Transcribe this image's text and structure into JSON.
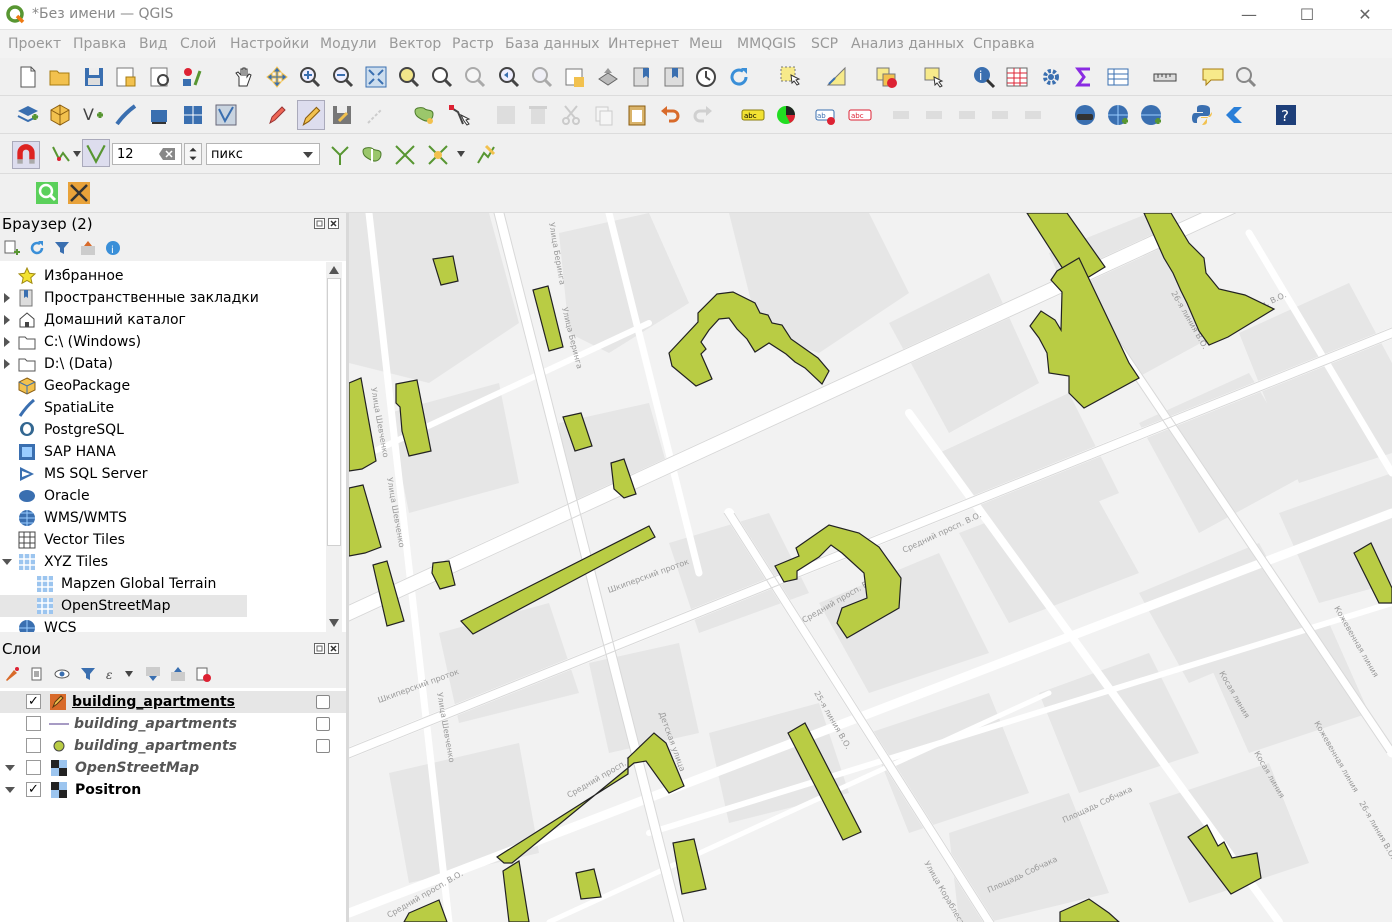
{
  "window": {
    "title": "*Без имени — QGIS",
    "controls": {
      "minimize": "—",
      "maximize": "☐",
      "close": "✕"
    }
  },
  "menu": [
    "Проект",
    "Правка",
    "Вид",
    "Слой",
    "Настройки",
    "Модули",
    "Вектор",
    "Растр",
    "База данных",
    "Интернет",
    "Меш",
    "MMQGIS",
    "SCP",
    "Анализ данных",
    "Справка"
  ],
  "snapping": {
    "tolerance_value": "12",
    "units_value": "пикс"
  },
  "browser": {
    "title": "Браузер (2)",
    "items": [
      {
        "label": "Избранное",
        "icon": "star-icon",
        "expander": ""
      },
      {
        "label": "Пространственные закладки",
        "icon": "bookmarks-icon",
        "expander": "collapsed"
      },
      {
        "label": "Домашний каталог",
        "icon": "home-folder-icon",
        "expander": "collapsed"
      },
      {
        "label": "C:\\ (Windows)",
        "icon": "folder-icon",
        "expander": "collapsed"
      },
      {
        "label": "D:\\ (Data)",
        "icon": "folder-icon",
        "expander": "collapsed"
      },
      {
        "label": "GeoPackage",
        "icon": "geopackage-icon",
        "expander": ""
      },
      {
        "label": "SpatiaLite",
        "icon": "spatialite-icon",
        "expander": ""
      },
      {
        "label": "PostgreSQL",
        "icon": "postgresql-icon",
        "expander": ""
      },
      {
        "label": "SAP HANA",
        "icon": "sap-hana-icon",
        "expander": ""
      },
      {
        "label": "MS SQL Server",
        "icon": "mssql-icon",
        "expander": ""
      },
      {
        "label": "Oracle",
        "icon": "oracle-icon",
        "expander": ""
      },
      {
        "label": "WMS/WMTS",
        "icon": "wms-globe-icon",
        "expander": ""
      },
      {
        "label": "Vector Tiles",
        "icon": "vector-tiles-icon",
        "expander": ""
      },
      {
        "label": "XYZ Tiles",
        "icon": "xyz-tiles-icon",
        "expander": "expanded"
      },
      {
        "label": "Mapzen Global Terrain",
        "icon": "xyz-tile-layer-icon",
        "expander": "child"
      },
      {
        "label": "OpenStreetMap",
        "icon": "xyz-tile-layer-icon",
        "expander": "child"
      },
      {
        "label": "WCS",
        "icon": "wcs-globe-icon",
        "expander": ""
      }
    ]
  },
  "layers": {
    "title": "Слои",
    "items": [
      {
        "label": "building_apartments",
        "checked": true,
        "symbol": "polygon-edit",
        "underline": true,
        "italic": false
      },
      {
        "label": "building_apartments",
        "checked": false,
        "symbol": "line",
        "underline": false,
        "italic": true
      },
      {
        "label": "building_apartments",
        "checked": false,
        "symbol": "point",
        "underline": false,
        "italic": true
      },
      {
        "label": "OpenStreetMap",
        "checked": false,
        "symbol": "raster",
        "underline": false,
        "italic": true,
        "expander": "expanded"
      },
      {
        "label": "Positron",
        "checked": true,
        "symbol": "raster",
        "underline": false,
        "italic": false,
        "expander": "expanded"
      }
    ]
  },
  "map": {
    "building_fill": "#b9cc44",
    "building_stroke": "#222222",
    "street_labels": [
      "Улица Беринга",
      "Улица Беринга",
      "Улица Шевченко",
      "Улица Шевченко",
      "Улица Шевченко",
      "Шкиперский проток",
      "Шкиперский проток",
      "Средний просп. В.О.",
      "Средний просп. В.О.",
      "Средний просп. В.О.",
      "Средний просп. В.О.",
      "Средний просп. В.О.",
      "Детская улица",
      "25-я линия В.О.",
      "26-я линия В.О.",
      "Кожевенная линия",
      "Кожевенная линия",
      "Косая линия",
      "Косая линия",
      "Площадь Собчака",
      "Площадь Собчака",
      "Улица Кораблестроителей",
      "26-я линия В.О."
    ]
  },
  "colors": {
    "accent": "#589632",
    "panel_bg": "#f0f0f0",
    "map_bg": "#f2f2f2"
  }
}
